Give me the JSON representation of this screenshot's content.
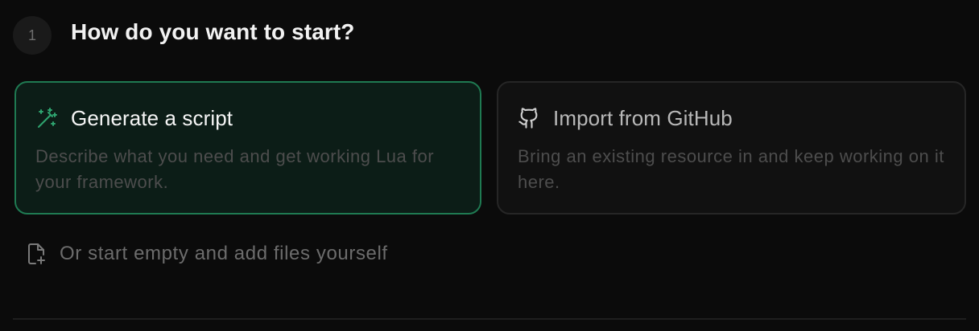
{
  "step": {
    "number": "1",
    "title": "How do you want to start?"
  },
  "options": [
    {
      "id": "generate",
      "icon": "magic-wand-icon",
      "title": "Generate a script",
      "description": "Describe what you need and get working Lua for your framework.",
      "selected": true
    },
    {
      "id": "github",
      "icon": "github-icon",
      "title": "Import from GitHub",
      "description": "Bring an existing resource in and keep working on it here.",
      "selected": false
    }
  ],
  "empty_option": {
    "icon": "file-plus-icon",
    "label": "Or start empty and add files yourself"
  },
  "colors": {
    "background": "#0b0b0b",
    "accent": "#2ea36f",
    "selected_border": "#1f7a52",
    "selected_background": "#0c1d17"
  }
}
